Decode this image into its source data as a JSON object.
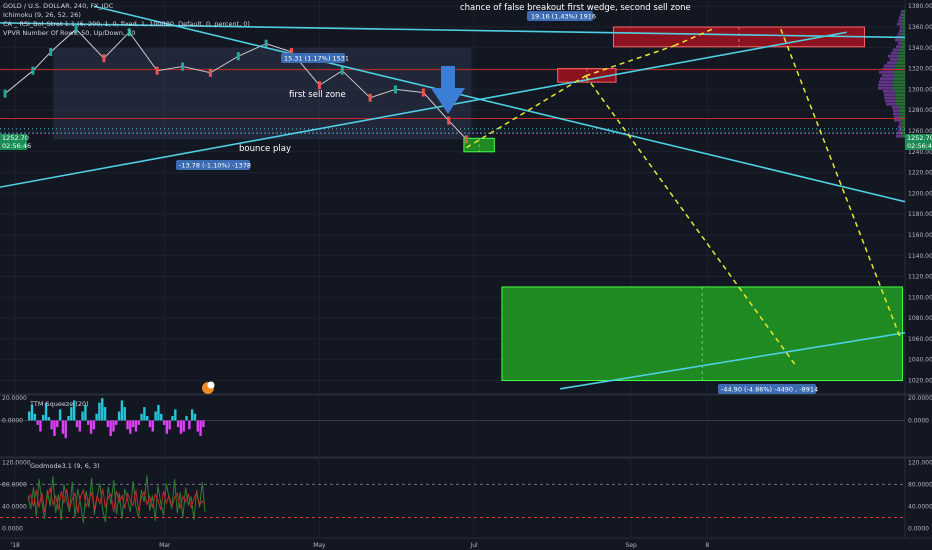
{
  "header": {
    "symbol": "GOLD / U.S. DOLLAR, 240, FX_IDC",
    "indicators": [
      "Ichimoku (9, 26, 52, 26)",
      "CA _ RSI_Bol_Strat 1.1 (6, 200, 1, 0, fixed, 1, 100000, Default, 0, percent, 0)",
      "VPVR Number Of Rows, 50, Up/Down, 70"
    ]
  },
  "annotations": {
    "false_breakout": "chance of false breakout first wedge, second sell zone",
    "first_sell_zone": "first sell zone",
    "bounce_play": "bounce play"
  },
  "measures": {
    "top_zone": "19.16 (1.43%) 1916",
    "sell_zone": "15.31 (1.17%) 1531",
    "bounce": "-13.78 (-1.10%) -1378",
    "target": "-44.90 (-4.86%) -4490 , -8914"
  },
  "price_tags": {
    "left_upper": "1252.70",
    "left_lower": "02:56:46",
    "right_upper": "1252.70",
    "right_lower": "02:56:46"
  },
  "panes": {
    "ttm_label": "TTM Squeeze (20)",
    "godmode_label": "Godmode3.1 (9, 6, 3)"
  },
  "colors": {
    "background": "#131722",
    "trendline": "#4dd0e1",
    "projection": "#e6e633",
    "buy_zone": "#22a822",
    "sell_zone": "#a3121e",
    "down_arrow": "#3a7fd5",
    "squeeze_positive": "#26c6da",
    "squeeze_negative": "#e040fb"
  },
  "chart_data": [
    {
      "type": "line",
      "pane": "price",
      "title": "GOLD / U.S. DOLLAR, 240, FX_IDC",
      "y_ticks": [
        1380,
        1360,
        1340,
        1320,
        1300,
        1280,
        1260,
        1240,
        1220,
        1200,
        1180,
        1160,
        1140,
        1120,
        1100,
        1080,
        1060,
        1040,
        1020
      ],
      "y_tick_labels": [
        "1380.00",
        "1360.00",
        "1340.00",
        "1320.00",
        "1300.00",
        "1280.00",
        "1260.00",
        "1240.00",
        "1220.00",
        "1200.00",
        "1180.00",
        "1160.00",
        "1140.00",
        "1120.00",
        "1100.00",
        "1080.00",
        "1060.00",
        "1040.00",
        "1020.00"
      ],
      "ylim": [
        1008,
        1386
      ],
      "x_tick_labels": [
        "'18",
        "Mar",
        "May",
        "Jul",
        "Sep",
        "8"
      ],
      "x_tick_dates": [
        "2018-01-01",
        "2018-03-01",
        "2018-05-01",
        "2018-07-01",
        "2018-09-01",
        "2018-10-01"
      ],
      "xlim": [
        "2017-12-26",
        "2018-12-18"
      ],
      "series": [
        {
          "x": [
            "2017-12-28",
            "2018-01-08",
            "2018-01-15",
            "2018-01-25",
            "2018-02-05",
            "2018-02-15",
            "2018-02-26",
            "2018-03-08",
            "2018-03-19",
            "2018-03-30",
            "2018-04-10",
            "2018-04-20",
            "2018-05-01",
            "2018-05-10",
            "2018-05-21",
            "2018-05-31",
            "2018-06-11",
            "2018-06-21",
            "2018-06-28"
          ],
          "values": [
            1296,
            1318,
            1336,
            1358,
            1330,
            1355,
            1318,
            1322,
            1316,
            1332,
            1344,
            1336,
            1304,
            1318,
            1292,
            1300,
            1297,
            1270,
            1252
          ]
        }
      ],
      "zones": [
        {
          "label": "19.16 (1.43%) 1916",
          "start": "2018-08-25",
          "end": "2018-12-02",
          "low": 1341,
          "high": 1360,
          "color": "sell"
        },
        {
          "label": "15.31 (1.17%) 1531",
          "start": "2018-08-03",
          "end": "2018-08-26",
          "low": 1307,
          "high": 1320,
          "color": "sell"
        },
        {
          "label": "-13.78 (-1.10%) -1378",
          "start": "2018-06-27",
          "end": "2018-07-09",
          "low": 1240,
          "high": 1253,
          "color": "buy"
        },
        {
          "label": "-44.90 (-4.86%) -4490 , -8914",
          "start": "2018-07-12",
          "end": "2018-12-17",
          "low": 1020,
          "high": 1110,
          "color": "buy"
        }
      ],
      "trendlines": [
        {
          "from": [
            "2017-12-26",
            1364
          ],
          "to": [
            "2018-12-18",
            1350
          ]
        },
        {
          "from": [
            "2017-12-26",
            1206
          ],
          "to": [
            "2018-11-25",
            1355
          ]
        },
        {
          "from": [
            "2018-02-01",
            1380
          ],
          "to": [
            "2018-12-18",
            1192
          ]
        },
        {
          "from": [
            "2018-08-04",
            1012
          ],
          "to": [
            "2018-12-18",
            1066
          ]
        }
      ],
      "projections": [
        {
          "from": [
            "2018-06-28",
            1244
          ],
          "to": [
            "2018-08-14",
            1313
          ]
        },
        {
          "from": [
            "2018-08-14",
            1313
          ],
          "to": [
            "2018-09-18",
            1342
          ]
        },
        {
          "from": [
            "2018-09-18",
            1342
          ],
          "to": [
            "2018-10-03",
            1358
          ]
        },
        {
          "from": [
            "2018-08-14",
            1313
          ],
          "to": [
            "2018-11-05",
            1034
          ]
        },
        {
          "from": [
            "2018-10-30",
            1358
          ],
          "to": [
            "2018-12-16",
            1062
          ]
        }
      ],
      "horizontal_levels": [
        1319,
        1272
      ]
    },
    {
      "type": "bar",
      "pane": "ttm",
      "title": "TTM Squeeze (20)",
      "y_tick_labels": [
        "20.0000",
        "0.0000"
      ],
      "ylim": [
        -32,
        22
      ],
      "values": [
        8,
        14,
        6,
        -4,
        -10,
        5,
        16,
        3,
        -8,
        -14,
        -6,
        10,
        -12,
        -16,
        4,
        12,
        18,
        -6,
        -10,
        8,
        14,
        -4,
        -12,
        -8,
        6,
        16,
        20,
        12,
        -6,
        -14,
        -10,
        -4,
        8,
        18,
        12,
        -8,
        -12,
        -6,
        -10,
        -4,
        6,
        12,
        4,
        -6,
        -10,
        8,
        14,
        6,
        -4,
        -12,
        -8,
        4,
        10,
        -6,
        -12,
        -10,
        4,
        -8,
        10,
        6,
        -10,
        -14,
        -6
      ]
    },
    {
      "type": "line",
      "pane": "godmode",
      "title": "Godmode3.1 (9, 6, 3)",
      "y_tick_labels": [
        "120.0000",
        "80.0000",
        "40.0000",
        "0.0000"
      ],
      "ylim": [
        -8,
        126
      ],
      "levels": [
        80,
        20
      ],
      "series": [
        {
          "name": "",
          "values": [
            60,
            35,
            75,
            22,
            90,
            48,
            18,
            70,
            40,
            95,
            28,
            62,
            15,
            80,
            50,
            30,
            85,
            20,
            72,
            45,
            10,
            68,
            38,
            92,
            25,
            58,
            82,
            34,
            12,
            76,
            44,
            88,
            26,
            64,
            18,
            72,
            52,
            30,
            86,
            40,
            20,
            70,
            48,
            96,
            32,
            60,
            14,
            78,
            46,
            24,
            82,
            56,
            36,
            90,
            28,
            66,
            20,
            74,
            42,
            58,
            16,
            70,
            38,
            84,
            30
          ]
        },
        {
          "name": "",
          "values": [
            50,
            62,
            40,
            70,
            38,
            66,
            30,
            58,
            74,
            42,
            60,
            34,
            68,
            46,
            72,
            36,
            54,
            64,
            28,
            58,
            70,
            40,
            52,
            66,
            34,
            60,
            44,
            72,
            38,
            56,
            62,
            30,
            68,
            48,
            60,
            36,
            64,
            50,
            42,
            70,
            32,
            56,
            66,
            44,
            58,
            38,
            62,
            52,
            34,
            68,
            46,
            60,
            40,
            56,
            64,
            36,
            58,
            48,
            62,
            38,
            54,
            66,
            42,
            50,
            44
          ]
        }
      ]
    }
  ]
}
